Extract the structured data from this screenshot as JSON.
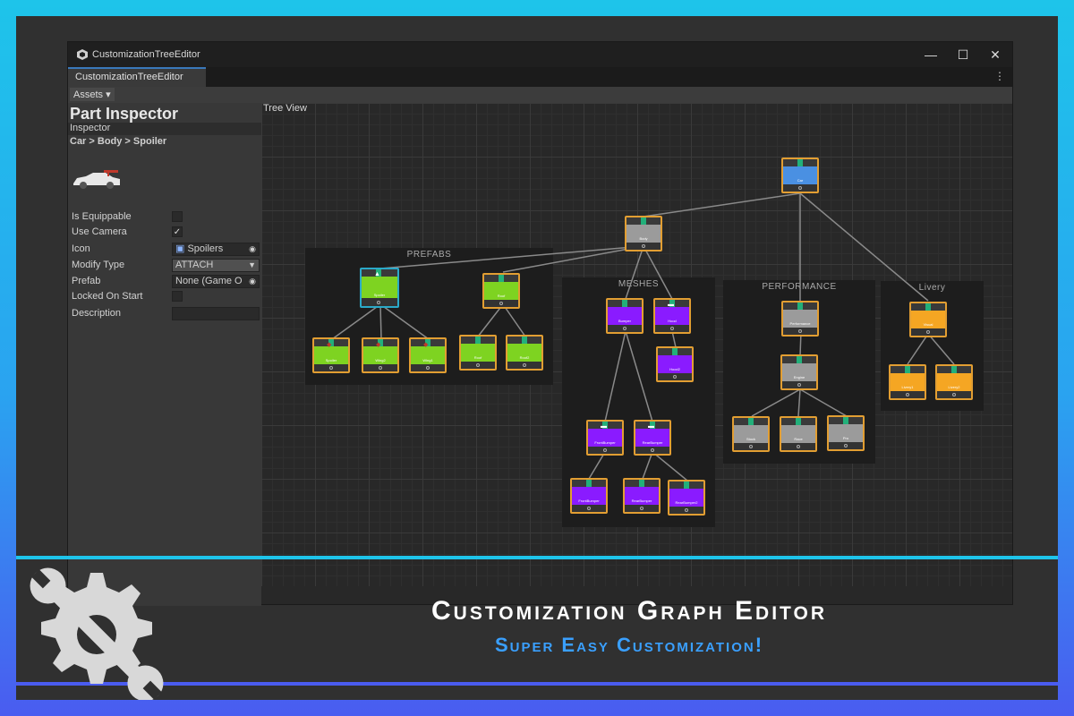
{
  "window": {
    "title": "CustomizationTreeEditor",
    "tab_label": "CustomizationTreeEditor",
    "minimize": "—",
    "maximize": "☐",
    "close": "✕",
    "tab_menu": "⋮"
  },
  "toolbar": {
    "assets_label": "Assets ▾"
  },
  "inspector": {
    "title": "Part Inspector",
    "subtitle": "Inspector",
    "breadcrumb": "Car > Body > Spoiler",
    "is_equippable_label": "Is Equippable",
    "use_camera_label": "Use Camera",
    "use_camera_check": "✓",
    "icon_label": "Icon",
    "icon_value": "Spoilers",
    "modify_type_label": "Modify Type",
    "modify_type_value": "ATTACH",
    "prefab_label": "Prefab",
    "prefab_value": "None (Game O",
    "locked_on_start_label": "Locked On Start",
    "description_label": "Description",
    "description_value": ""
  },
  "tree": {
    "label": "Tree View",
    "groups": {
      "prefabs": "PREFABS",
      "meshes": "MESHES",
      "performance": "PERFORMANCE",
      "livery": "Livery"
    },
    "nodes": {
      "car": "Car",
      "body": "Body",
      "spoiler": "Spoiler",
      "roof": "Roof",
      "spoiler_a": "Spoiler",
      "wing2": "Wing2",
      "wing1": "Wing1",
      "roof_a": "Roof",
      "roof2": "Roof2",
      "bumper": "Bumper",
      "hood": "Hood",
      "hood2": "Hood2",
      "front_bumper": "FrontBumper",
      "rear_bumper": "RearBumper",
      "front_bumper2": "FrontBumper",
      "rear_bumper2": "RearBumper",
      "rear_bumper3": "RearBumper2",
      "performance": "Performance",
      "engine": "Engine",
      "stock": "Stock",
      "race": "Race",
      "pro": "Pro",
      "visual": "Visual",
      "livery1": "Livery1",
      "livery2": "Livery2"
    }
  },
  "banner": {
    "title": "Customization Graph Editor",
    "subtitle": "Super Easy Customization!"
  },
  "colors": {
    "selected_node_border": "#2aa9c9",
    "node_border": "#e29e32",
    "prefab_green": "#7ed321",
    "mesh_purple": "#8a1bff",
    "perf_gray": "#9b9b9b",
    "livery_orange": "#f5a623",
    "root_blue": "#4a90e2"
  }
}
